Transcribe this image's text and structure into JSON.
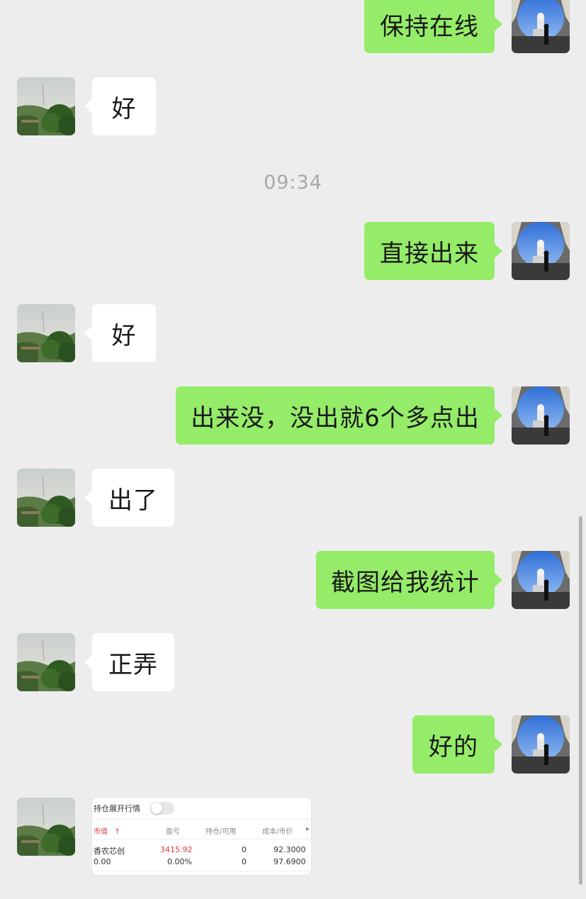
{
  "timestamp": "09:34",
  "messages": [
    {
      "from": "self",
      "text": "保持在线"
    },
    {
      "from": "other",
      "text": "好"
    },
    {
      "from": "self",
      "text": "直接出来"
    },
    {
      "from": "other",
      "text": "好"
    },
    {
      "from": "self",
      "text": "出来没，没出就6个多点出"
    },
    {
      "from": "other",
      "text": "出了"
    },
    {
      "from": "self",
      "text": "截图给我统计"
    },
    {
      "from": "other",
      "text": "正弄"
    },
    {
      "from": "self",
      "text": "好的"
    },
    {
      "from": "other",
      "type": "image"
    }
  ],
  "screenshot": {
    "toggle_label": "持仓展开行情",
    "headers": {
      "market_value": "市值",
      "sort_arrow": "↑",
      "pnl": "盈亏",
      "position": "持仓/可用",
      "cost_price": "成本/市价",
      "more": "▸"
    },
    "row": {
      "name": "香农芯创",
      "pnl": "3415.92",
      "position": "0",
      "cost": "92.3000",
      "market_value": "0.00",
      "pnl_pct": "0.00%",
      "available": "0",
      "price": "97.6900"
    }
  },
  "colors": {
    "background": "#ededed",
    "self_bubble": "#95ec69",
    "other_bubble": "#ffffff",
    "profit_red": "#e0383e"
  },
  "icons": {
    "self_avatar": "buddha-statue-sky-photo",
    "other_avatar": "green-hill-tree-photo"
  }
}
